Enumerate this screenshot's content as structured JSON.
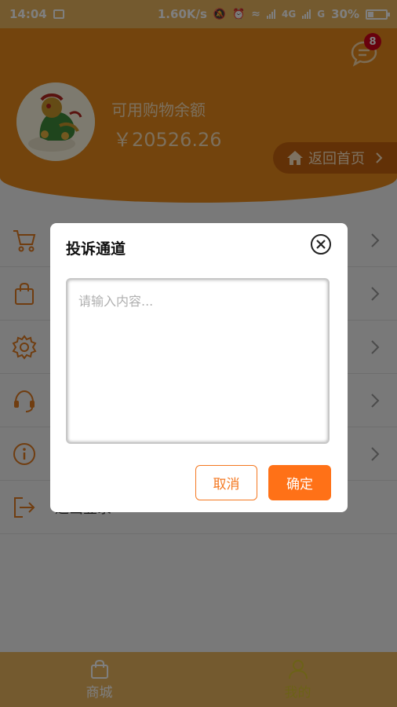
{
  "status_bar": {
    "time": "14:04",
    "network_speed": "1.60K/s",
    "signal_1": "4G",
    "signal_2": "G",
    "battery": "30%"
  },
  "header": {
    "message_badge": "8",
    "balance_label": "可用购物余额",
    "balance_value": "￥20526.26",
    "home_button": "返回首页"
  },
  "menu": {
    "items": [
      {
        "icon": "cart-icon",
        "label": ""
      },
      {
        "icon": "bag-icon",
        "label": ""
      },
      {
        "icon": "gear-icon",
        "label": ""
      },
      {
        "icon": "headset-icon",
        "label": ""
      },
      {
        "icon": "info-icon",
        "label": ""
      },
      {
        "icon": "logout-icon",
        "label": "退出登录"
      }
    ]
  },
  "tabbar": {
    "tabs": [
      {
        "label": "商城",
        "icon": "shopping-bag-icon",
        "active": false
      },
      {
        "label": "我的",
        "icon": "user-icon",
        "active": true
      }
    ]
  },
  "dialog": {
    "title": "投诉通道",
    "textarea_placeholder": "请输入内容...",
    "textarea_value": "",
    "cancel_label": "取消",
    "confirm_label": "确定"
  },
  "colors": {
    "header_orange": "#e6881b",
    "status_bar": "#e9b55f",
    "accent_orange": "#ff7117",
    "home_button_bg": "#c5630f",
    "active_tab": "#d9c42f",
    "icon_orange": "#e07a20"
  }
}
